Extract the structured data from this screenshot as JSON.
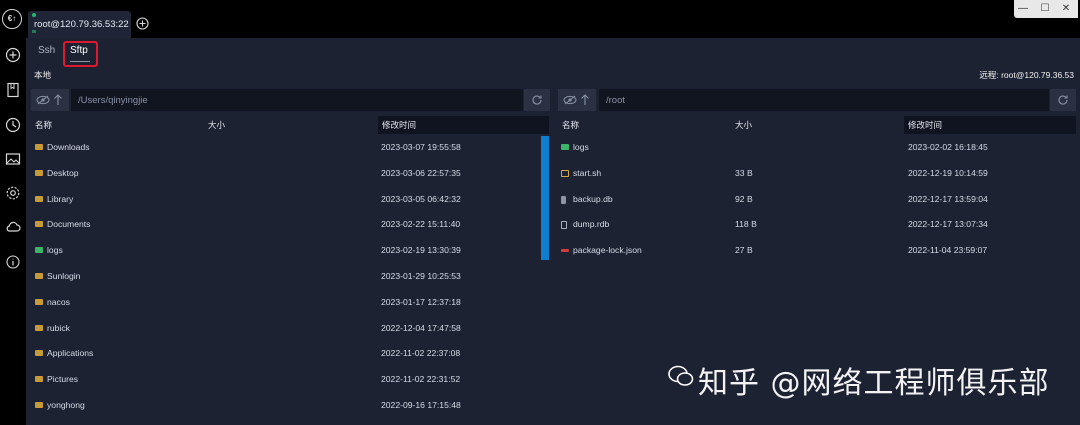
{
  "app": {
    "logo_text": "€↑"
  },
  "tabs": [
    {
      "label": "root@120.79.36.53:22"
    }
  ],
  "subtabs": {
    "ssh": "Ssh",
    "sftp": "Sftp"
  },
  "local": {
    "label": "本地",
    "path": "/Users/qinyingjie",
    "columns": {
      "name": "名称",
      "size": "大小",
      "mtime": "修改时间"
    },
    "files": [
      {
        "name": "Downloads",
        "size": "",
        "mtime": "2023-03-07 19:55:58",
        "type": "folder"
      },
      {
        "name": "Desktop",
        "size": "",
        "mtime": "2023-03-06 22:57:35",
        "type": "folder"
      },
      {
        "name": "Library",
        "size": "",
        "mtime": "2023-03-05 06:42:32",
        "type": "folder"
      },
      {
        "name": "Documents",
        "size": "",
        "mtime": "2023-02-22 15:11:40",
        "type": "folder"
      },
      {
        "name": "logs",
        "size": "",
        "mtime": "2023-02-19 13:30:39",
        "type": "folder-green"
      },
      {
        "name": "Sunlogin",
        "size": "",
        "mtime": "2023-01-29 10:25:53",
        "type": "folder"
      },
      {
        "name": "nacos",
        "size": "",
        "mtime": "2023-01-17 12:37:18",
        "type": "folder"
      },
      {
        "name": "rubick",
        "size": "",
        "mtime": "2022-12-04 17:47:58",
        "type": "folder"
      },
      {
        "name": "Applications",
        "size": "",
        "mtime": "2022-11-02 22:37:08",
        "type": "folder"
      },
      {
        "name": "Pictures",
        "size": "",
        "mtime": "2022-11-02 22:31:52",
        "type": "folder"
      },
      {
        "name": "yonghong",
        "size": "",
        "mtime": "2022-09-16 17:15:48",
        "type": "folder"
      }
    ]
  },
  "remote": {
    "label": "远程: root@120.79.36.53",
    "path": "/root",
    "columns": {
      "name": "名称",
      "size": "大小",
      "mtime": "修改时间"
    },
    "files": [
      {
        "name": "logs",
        "size": "",
        "mtime": "2023-02-02 16:18:45",
        "type": "folder-green"
      },
      {
        "name": "start.sh",
        "size": "33 B",
        "mtime": "2022-12-19 10:14:59",
        "type": "sh"
      },
      {
        "name": "backup.db",
        "size": "92 B",
        "mtime": "2022-12-17 13:59:04",
        "type": "db"
      },
      {
        "name": "dump.rdb",
        "size": "118 B",
        "mtime": "2022-12-17 13:07:34",
        "type": "rdb"
      },
      {
        "name": "package-lock.json",
        "size": "27 B",
        "mtime": "2022-11-04 23:59:07",
        "type": "json"
      }
    ]
  },
  "watermark": {
    "text": "知乎 @网络工程师俱乐部"
  },
  "colors": {
    "panel": "#1d2233",
    "accent": "#0f7ecf",
    "highlight": "#e0182d",
    "folder": "#c79a3a"
  }
}
